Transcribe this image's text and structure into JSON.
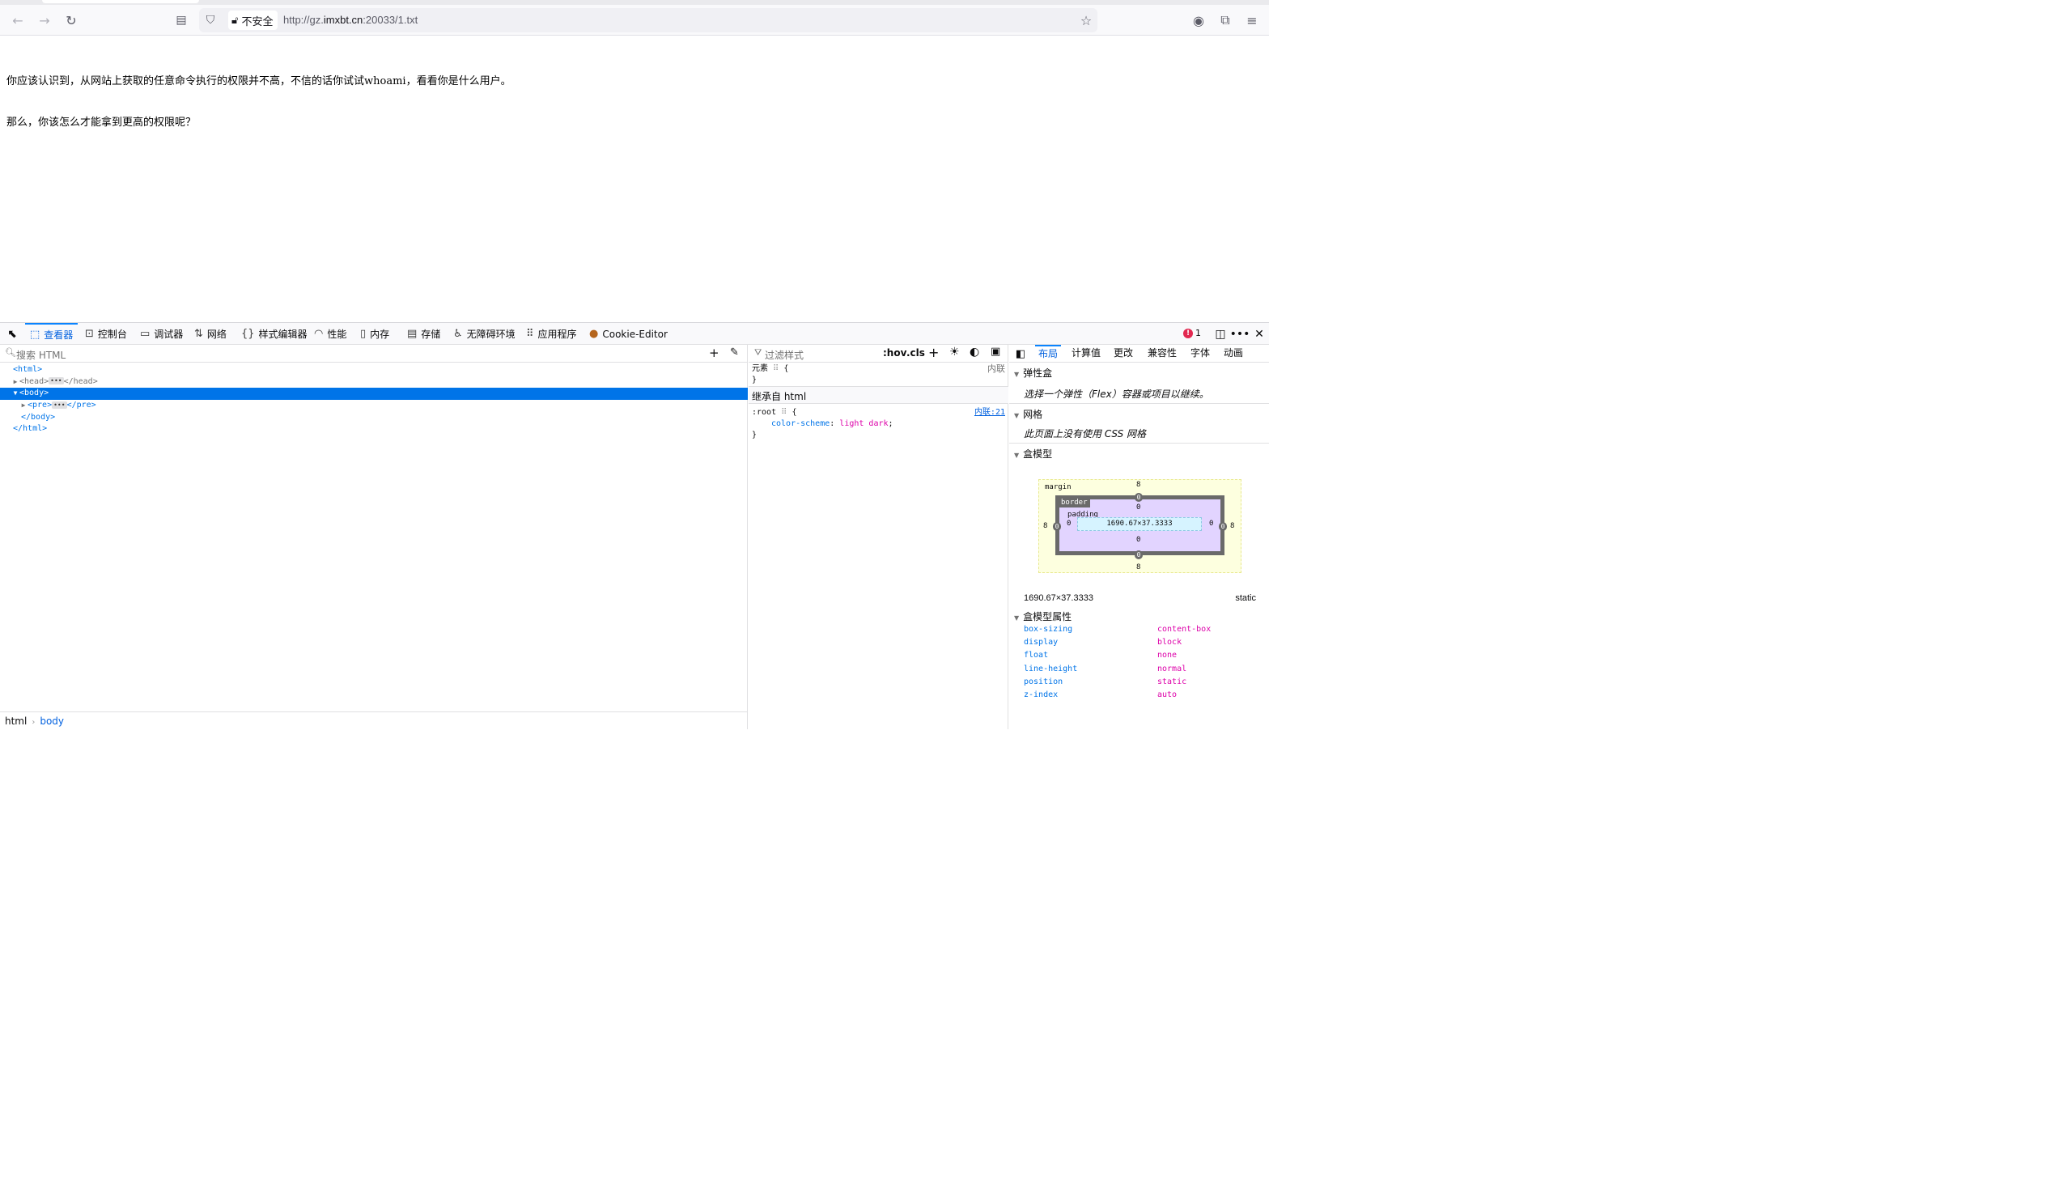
{
  "browser": {
    "insecure_label": "不安全",
    "url_scheme": "http://gz.",
    "url_host": "imxbt.cn",
    "url_rest": ":20033/1.txt"
  },
  "page": {
    "lines": [
      "你应该认识到，从网站上获取的任意命令执行的权限并不高，不信的话你试试whoami，看看你是什么用户。",
      "那么，你该怎么才能拿到更高的权限呢？"
    ]
  },
  "devtools": {
    "tabs": [
      {
        "label": "查看器",
        "icon": "inspector-icon"
      },
      {
        "label": "控制台",
        "icon": "console-icon"
      },
      {
        "label": "调试器",
        "icon": "debugger-icon"
      },
      {
        "label": "网络",
        "icon": "network-icon"
      },
      {
        "label": "样式编辑器",
        "icon": "style-editor-icon"
      },
      {
        "label": "性能",
        "icon": "performance-icon"
      },
      {
        "label": "内存",
        "icon": "memory-icon"
      },
      {
        "label": "存储",
        "icon": "storage-icon"
      },
      {
        "label": "无障碍环境",
        "icon": "accessibility-icon"
      },
      {
        "label": "应用程序",
        "icon": "application-icon"
      },
      {
        "label": "Cookie-Editor",
        "icon": "cookie-icon"
      }
    ],
    "error_count": "1",
    "inspector": {
      "search_placeholder": "搜索 HTML",
      "breadcrumb_root": "html",
      "breadcrumb_current": "body"
    },
    "rules": {
      "filter_placeholder": "过滤样式",
      "hov_label": ":hov",
      "cls_label": ".cls",
      "element_selector": "元素",
      "element_source": "内联",
      "inherited_header": "继承自 html",
      "root_selector": ":root",
      "root_source": "内联:21",
      "root_prop": "color-scheme",
      "root_value": "light dark"
    },
    "layout": {
      "tabs": [
        "布局",
        "计算值",
        "更改",
        "兼容性",
        "字体",
        "动画"
      ],
      "flexbox_header": "弹性盒",
      "flexbox_note": "选择一个弹性（Flex）容器或项目以继续。",
      "grid_header": "网格",
      "grid_note": "此页面上没有使用 CSS 网格",
      "boxmodel_header": "盒模型",
      "margin_label": "margin",
      "border_label": "border",
      "padding_label": "padding",
      "content_size": "1690.67×37.3333",
      "margin_top": "8",
      "margin_right": "8",
      "margin_bottom": "8",
      "margin_left": "8",
      "border_top": "0",
      "border_right": "0",
      "border_bottom": "0",
      "border_left": "0",
      "padding_top": "0",
      "padding_right": "0",
      "padding_bottom": "0",
      "padding_left": "0",
      "dimensions": "1690.67×37.3333",
      "position": "static",
      "props_header": "盒模型属性",
      "props": [
        {
          "k": "box-sizing",
          "v": "content-box"
        },
        {
          "k": "display",
          "v": "block"
        },
        {
          "k": "float",
          "v": "none"
        },
        {
          "k": "line-height",
          "v": "normal"
        },
        {
          "k": "position",
          "v": "static"
        },
        {
          "k": "z-index",
          "v": "auto"
        }
      ]
    }
  }
}
